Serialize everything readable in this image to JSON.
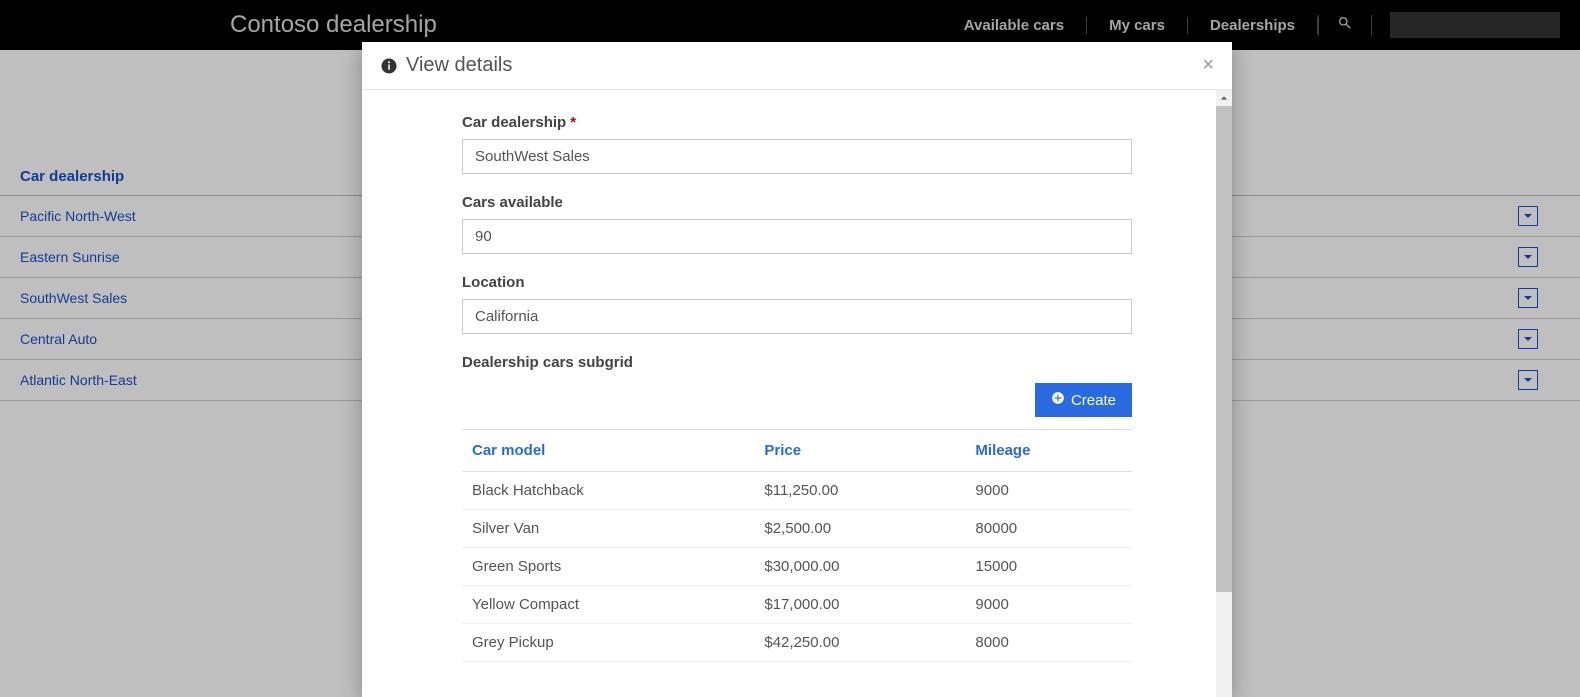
{
  "navbar": {
    "brand": "Contoso dealership",
    "links": [
      {
        "label": "Available cars"
      },
      {
        "label": "My cars"
      },
      {
        "label": "Dealerships"
      }
    ]
  },
  "listing": {
    "header": "Car dealership",
    "rows": [
      {
        "name": "Pacific North-West"
      },
      {
        "name": "Eastern Sunrise"
      },
      {
        "name": "SouthWest Sales"
      },
      {
        "name": "Central Auto"
      },
      {
        "name": "Atlantic North-East"
      }
    ]
  },
  "modal": {
    "title": "View details",
    "fields": {
      "dealership_label": "Car dealership",
      "dealership_value": "SouthWest Sales",
      "cars_available_label": "Cars available",
      "cars_available_value": "90",
      "location_label": "Location",
      "location_value": "California",
      "subgrid_label": "Dealership cars subgrid"
    },
    "create_label": "Create",
    "table": {
      "columns": {
        "model": "Car model",
        "price": "Price",
        "mileage": "Mileage"
      },
      "rows": [
        {
          "model": "Black Hatchback",
          "price": "$11,250.00",
          "mileage": "9000"
        },
        {
          "model": "Silver Van",
          "price": "$2,500.00",
          "mileage": "80000"
        },
        {
          "model": "Green Sports",
          "price": "$30,000.00",
          "mileage": "15000"
        },
        {
          "model": "Yellow Compact",
          "price": "$17,000.00",
          "mileage": "9000"
        },
        {
          "model": "Grey Pickup",
          "price": "$42,250.00",
          "mileage": "8000"
        }
      ]
    }
  }
}
